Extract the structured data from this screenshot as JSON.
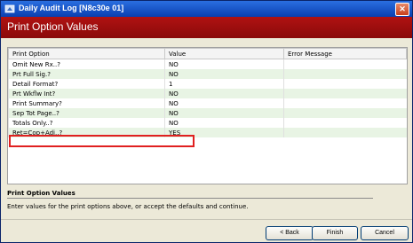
{
  "window": {
    "title": "Daily Audit Log [N8c30e 01]",
    "close_glyph": "✕",
    "titlebar_color": "#0a46c8"
  },
  "banner": {
    "heading": "Print Option Values",
    "color": "#9c0e0e"
  },
  "grid": {
    "columns": [
      "Print Option",
      "Value",
      "Error Message"
    ],
    "rows": [
      {
        "option": "Omit New Rx..?",
        "value": "NO",
        "error": ""
      },
      {
        "option": "Prt Full Sig.?",
        "value": "NO",
        "error": ""
      },
      {
        "option": "Detail Format?",
        "value": "1",
        "error": ""
      },
      {
        "option": "Prt Wkflw Int?",
        "value": "NO",
        "error": ""
      },
      {
        "option": "Print Summary?",
        "value": "NO",
        "error": ""
      },
      {
        "option": "Sep Tot Page..?",
        "value": "NO",
        "error": ""
      },
      {
        "option": "Totals Only..?",
        "value": "NO",
        "error": ""
      },
      {
        "option": "Ret=Cop+Adj..?",
        "value": "YES",
        "error": ""
      }
    ],
    "highlight_color": "#e02020"
  },
  "help": {
    "title": "Print Option Values",
    "text": "Enter values for the print options above, or accept the defaults and continue."
  },
  "buttons": {
    "back": "< Back",
    "finish": "Finish",
    "cancel": "Cancel"
  }
}
